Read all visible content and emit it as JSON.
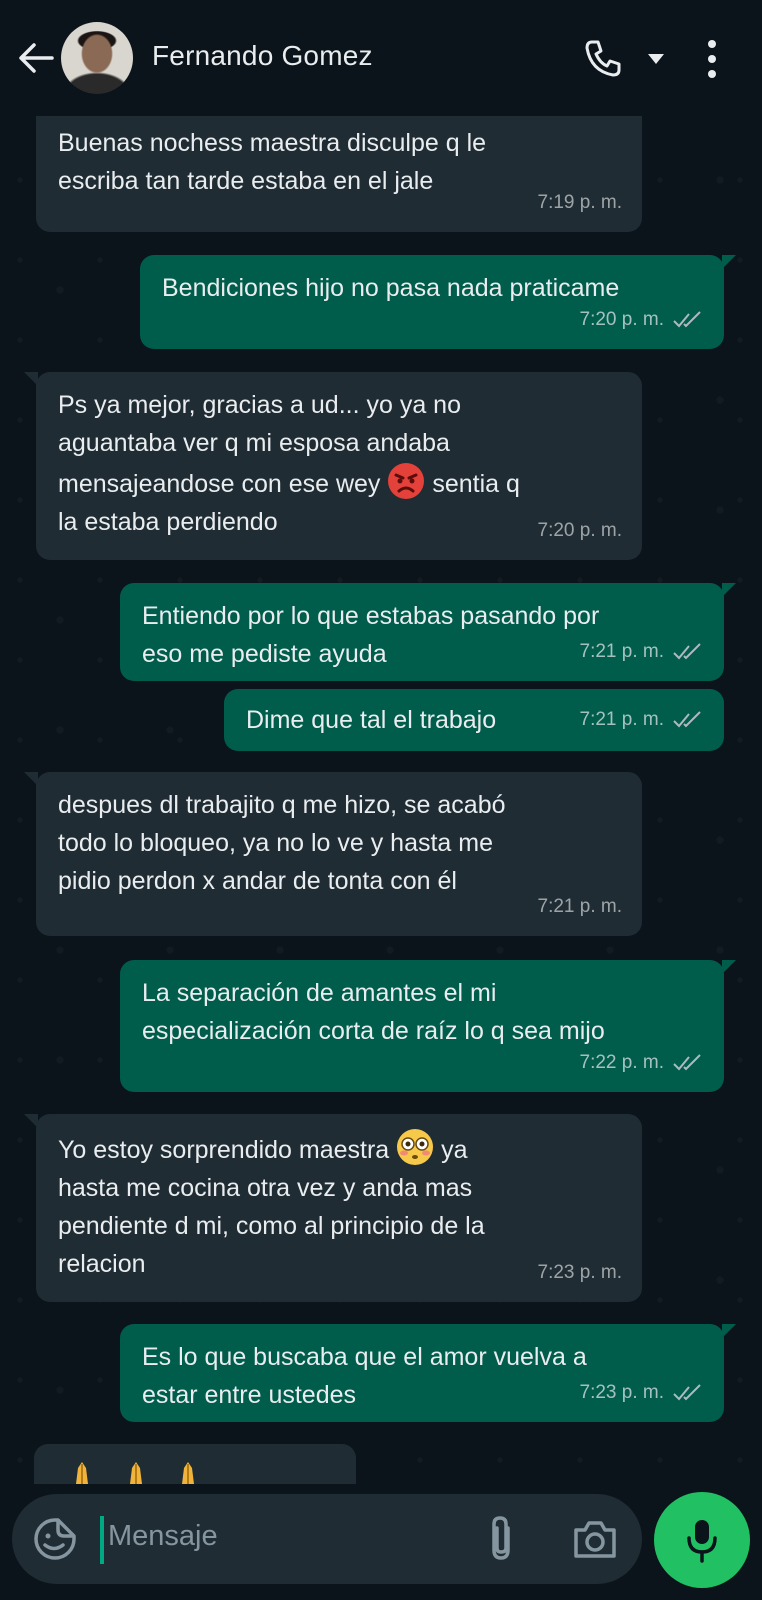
{
  "header": {
    "contact_name": "Fernando Gomez"
  },
  "messages": [
    {
      "direction": "in",
      "text_lines": [
        "Buenas nochess maestra disculpe q le",
        "escriba tan tarde estaba en el jale"
      ],
      "time": "7:19 p. m."
    },
    {
      "direction": "out",
      "text_lines": [
        "Bendiciones hijo no pasa nada praticame"
      ],
      "time": "7:20 p. m."
    },
    {
      "direction": "in",
      "text_lines": [
        "Ps ya mejor, gracias a ud... yo ya no",
        "aguantaba ver q mi esposa andaba",
        "mensajeandose con ese wey",
        "sentia q",
        "la estaba perdiendo"
      ],
      "emoji": "angry-face",
      "time": "7:20 p. m."
    },
    {
      "direction": "out",
      "text_lines": [
        "Entiendo por lo que estabas pasando por",
        "eso me pediste ayuda"
      ],
      "time": "7:21 p. m."
    },
    {
      "direction": "out",
      "text_lines": [
        "Dime que tal el trabajo"
      ],
      "time": "7:21 p. m."
    },
    {
      "direction": "in",
      "text_lines": [
        "despues dl trabajito q me hizo, se acabó",
        "todo lo bloqueo, ya no lo ve y hasta me",
        "pidio perdon x andar de tonta con él"
      ],
      "time": "7:21 p. m."
    },
    {
      "direction": "out",
      "text_lines": [
        "La separación de amantes el mi",
        "especialización corta de raíz lo q sea mijo"
      ],
      "time": "7:22 p. m."
    },
    {
      "direction": "in",
      "text_lines": [
        "Yo estoy sorprendido maestra",
        "ya",
        "hasta me cocina otra vez y anda mas",
        "pendiente d mi, como al principio de la",
        "relacion"
      ],
      "emoji": "flushed-face",
      "time": "7:23 p. m."
    },
    {
      "direction": "out",
      "text_lines": [
        "Es lo que buscaba que el amor vuelva a",
        "estar entre ustedes"
      ],
      "time": "7:23 p. m."
    }
  ],
  "composer": {
    "placeholder": "Mensaje"
  },
  "colors": {
    "incoming_bubble": "#202c33",
    "outgoing_bubble": "#005c4b",
    "mic_button": "#21c063",
    "background": "#0b141a"
  },
  "icons": [
    "back-arrow-icon",
    "phone-icon",
    "caret-down-icon",
    "more-vert-icon",
    "sticker-icon",
    "paperclip-icon",
    "camera-icon",
    "mic-icon",
    "double-check-icon",
    "praying-hands-emoji"
  ]
}
